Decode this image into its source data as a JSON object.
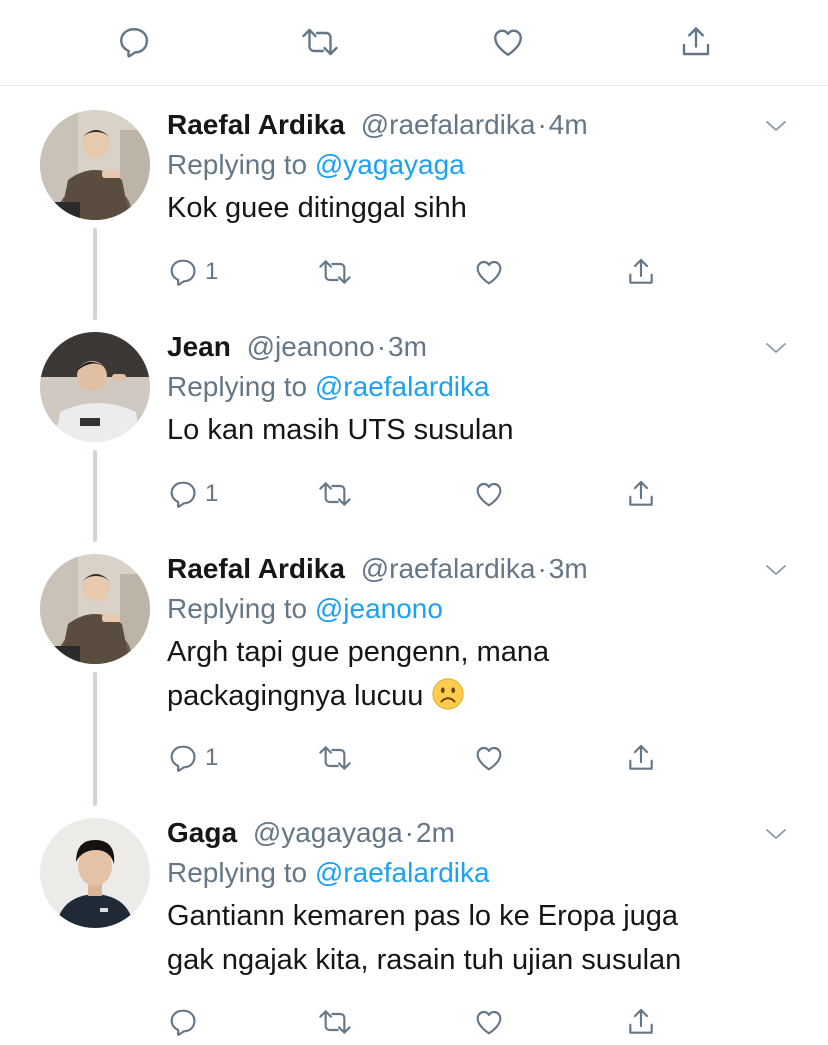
{
  "top_actions": {
    "icons": [
      "reply-icon",
      "retweet-icon",
      "like-icon",
      "share-icon"
    ]
  },
  "colors": {
    "link": "#1da1f2",
    "secondary": "#657786",
    "primary": "#14171a",
    "thread_line": "#ccd6dd"
  },
  "tweets": [
    {
      "name": "Raefal Ardika",
      "handle": "@raefalardika",
      "dot": "·",
      "time": "4m",
      "replying_label": "Replying to",
      "replying_to": "@yagayaga",
      "text_lines": [
        "Kok guee ditinggal sihh"
      ],
      "reply_count": "1"
    },
    {
      "name": "Jean",
      "handle": "@jeanono",
      "dot": "·",
      "time": "3m",
      "replying_label": "Replying to",
      "replying_to": "@raefalardika",
      "text_lines": [
        "Lo kan masih UTS susulan"
      ],
      "reply_count": "1"
    },
    {
      "name": "Raefal Ardika",
      "handle": "@raefalardika",
      "dot": "·",
      "time": "3m",
      "replying_label": "Replying to",
      "replying_to": "@jeanono",
      "text_lines": [
        "Argh tapi gue pengenn, mana",
        "packagingnya lucuu"
      ],
      "emoji": "frowning-face-emoji",
      "reply_count": "1"
    },
    {
      "name": "Gaga",
      "handle": "@yagayaga",
      "dot": "·",
      "time": "2m",
      "replying_label": "Replying to",
      "replying_to": "@raefalardika",
      "text_lines": [
        "Gantiann kemaren pas lo ke Eropa juga",
        "gak ngajak kita, rasain tuh ujian susulan"
      ],
      "reply_count": ""
    }
  ]
}
